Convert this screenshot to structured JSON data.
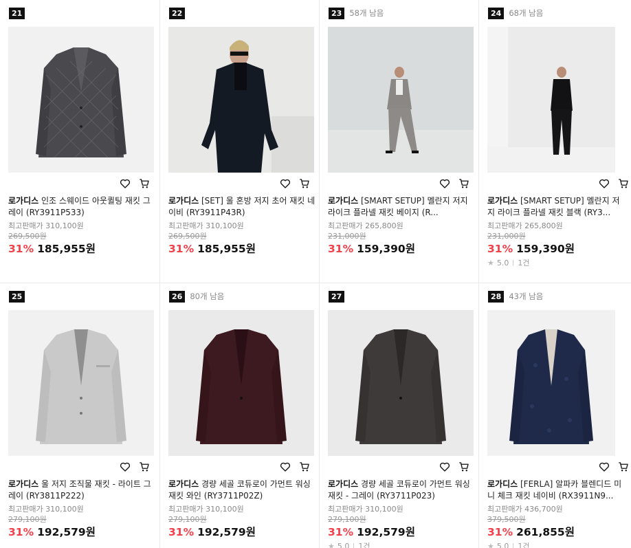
{
  "products": [
    {
      "rank": "21",
      "stock": "",
      "brand": "로가디스",
      "name": "인조 스웨이드 아웃퀼팅 재킷 그레이 (RY3911P533)",
      "max_price": "최고판매가 310,100원",
      "orig_price": "269,500원",
      "discount": "31%",
      "price": "185,955원",
      "rating": "",
      "reviews": ""
    },
    {
      "rank": "22",
      "stock": "",
      "brand": "로가디스",
      "name": "[SET] 울 혼방 저지 초어 재킷 네이비 (RY3911P43R)",
      "max_price": "최고판매가 310,100원",
      "orig_price": "269,500원",
      "discount": "31%",
      "price": "185,955원",
      "rating": "",
      "reviews": ""
    },
    {
      "rank": "23",
      "stock": "58개 남음",
      "brand": "로가디스",
      "name": "[SMART SETUP] 멜란지 저지 라이크 플라넬 재킷 베이지 (R...",
      "max_price": "최고판매가 265,800원",
      "orig_price": "231,000원",
      "discount": "31%",
      "price": "159,390원",
      "rating": "",
      "reviews": ""
    },
    {
      "rank": "24",
      "stock": "68개 남음",
      "brand": "로가디스",
      "name": "[SMART SETUP] 멜란지 저지 라이크 플라넬 재킷 블랙 (RY3...",
      "max_price": "최고판매가 265,800원",
      "orig_price": "231,000원",
      "discount": "31%",
      "price": "159,390원",
      "rating": "5.0",
      "reviews": "1건"
    },
    {
      "rank": "25",
      "stock": "",
      "brand": "로가디스",
      "name": "울 저지 조직물 재킷 - 라이트 그레이 (RY3811P222)",
      "max_price": "최고판매가 310,100원",
      "orig_price": "279,100원",
      "discount": "31%",
      "price": "192,579원",
      "rating": "",
      "reviews": ""
    },
    {
      "rank": "26",
      "stock": "80개 남음",
      "brand": "로가디스",
      "name": "경량 세골 코듀로이 가먼트 워싱 재킷 와인 (RY3711P02Z)",
      "max_price": "최고판매가 310,100원",
      "orig_price": "279,100원",
      "discount": "31%",
      "price": "192,579원",
      "rating": "",
      "reviews": ""
    },
    {
      "rank": "27",
      "stock": "",
      "brand": "로가디스",
      "name": "경량 세골 코듀로이 가먼트 워싱 재킷 - 그레이 (RY3711P023)",
      "max_price": "최고판매가 310,100원",
      "orig_price": "279,100원",
      "discount": "31%",
      "price": "192,579원",
      "rating": "5.0",
      "reviews": "1건"
    },
    {
      "rank": "28",
      "stock": "43개 남음",
      "brand": "로가디스",
      "name": "[FERLA] 알파카 블렌디드 미니 체크 재킷 네이비 (RX3911N9...",
      "max_price": "최고판매가 436,700원",
      "orig_price": "379,500원",
      "discount": "31%",
      "price": "261,855원",
      "rating": "5.0",
      "reviews": "1건"
    }
  ],
  "icons": {
    "wishlist": "heart-icon",
    "cart": "cart-icon",
    "star": "star-icon"
  },
  "colors": {
    "discount": "#f2414a",
    "rank_bg": "#111111"
  }
}
